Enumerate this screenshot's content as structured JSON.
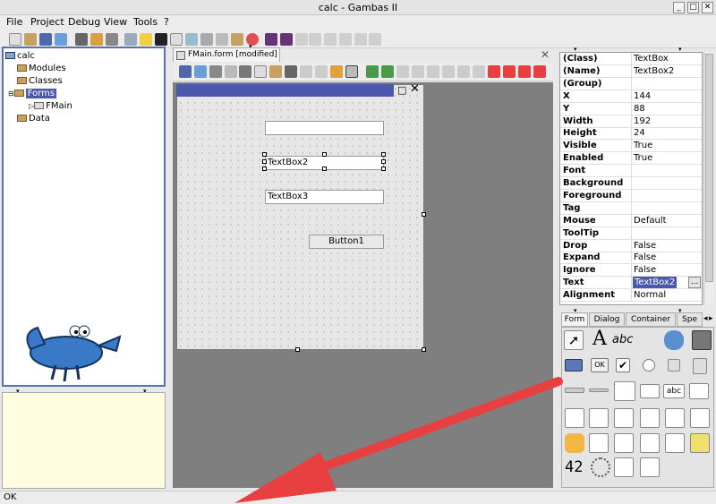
{
  "window": {
    "title": "calc - Gambas II"
  },
  "menu": [
    "File",
    "Project",
    "Debug",
    "View",
    "Tools",
    "?"
  ],
  "tree": {
    "root": "calc",
    "items": [
      "Modules",
      "Classes",
      "Forms",
      "FMain",
      "Data"
    ]
  },
  "editor": {
    "tab_label": "FMain.form [modified]"
  },
  "form": {
    "textbox2": "TextBox2",
    "textbox3": "TextBox3",
    "button1": "Button1"
  },
  "properties": [
    {
      "name": "(Class)",
      "value": "TextBox"
    },
    {
      "name": "(Name)",
      "value": "TextBox2"
    },
    {
      "name": "(Group)",
      "value": ""
    },
    {
      "name": "X",
      "value": "144"
    },
    {
      "name": "Y",
      "value": "88"
    },
    {
      "name": "Width",
      "value": "192"
    },
    {
      "name": "Height",
      "value": "24"
    },
    {
      "name": "Visible",
      "value": "True"
    },
    {
      "name": "Enabled",
      "value": "True"
    },
    {
      "name": "Font",
      "value": ""
    },
    {
      "name": "Background",
      "value": ""
    },
    {
      "name": "Foreground",
      "value": ""
    },
    {
      "name": "Tag",
      "value": ""
    },
    {
      "name": "Mouse",
      "value": "Default"
    },
    {
      "name": "ToolTip",
      "value": ""
    },
    {
      "name": "Drop",
      "value": "False"
    },
    {
      "name": "Expand",
      "value": "False"
    },
    {
      "name": "Ignore",
      "value": "False"
    },
    {
      "name": "Text",
      "value": "TextBox2"
    },
    {
      "name": "Alignment",
      "value": "Normal"
    }
  ],
  "toolbox": {
    "tabs": [
      "Form",
      "Dialog",
      "Container",
      "Spe"
    ],
    "font_glyph": "A",
    "label_glyph": "abc",
    "ok_glyph": "OK",
    "number_glyph": "42"
  },
  "status": "OK",
  "colors": {
    "selection": "#4c58ac",
    "arrow": "#e84040"
  }
}
